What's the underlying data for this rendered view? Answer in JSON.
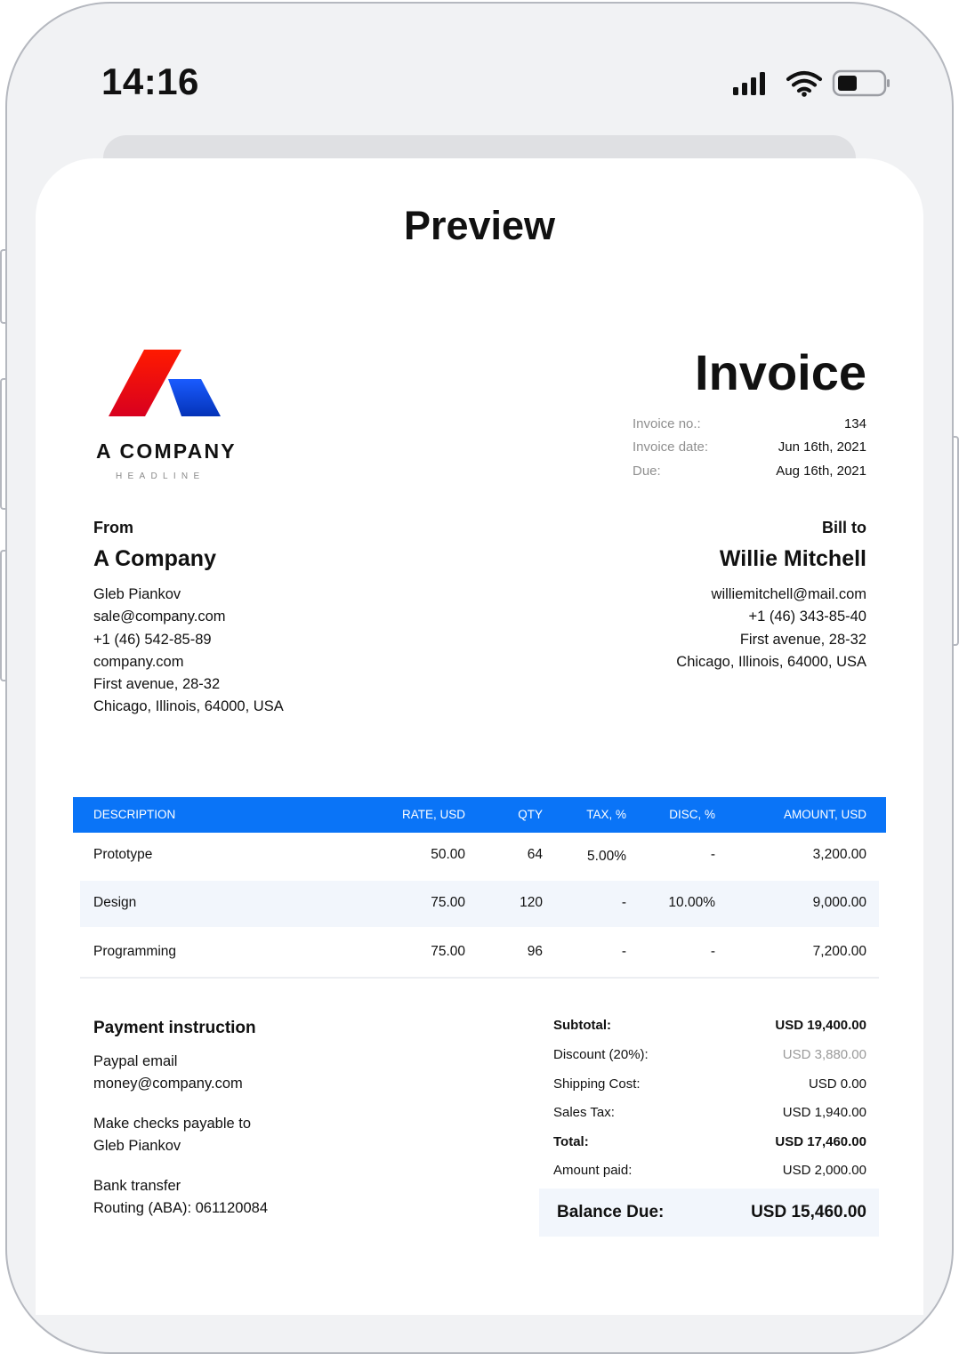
{
  "status_bar": {
    "time": "14:16",
    "icons": [
      "signal-icon",
      "wifi-icon",
      "battery-icon"
    ]
  },
  "sheet": {
    "title": "Preview"
  },
  "company": {
    "name": "A COMPANY",
    "headline": "HEADLINE",
    "logo_colors": [
      "#ff0000",
      "#0047e0"
    ]
  },
  "invoice": {
    "title": "Invoice",
    "meta": [
      {
        "label": "Invoice no.:",
        "value": "134"
      },
      {
        "label": "Invoice date:",
        "value": "Jun 16th, 2021"
      },
      {
        "label": "Due:",
        "value": "Aug 16th, 2021"
      }
    ]
  },
  "from": {
    "heading": "From",
    "name": "A Company",
    "lines": [
      "Gleb Piankov",
      "sale@company.com",
      "+1 (46) 542-85-89",
      "company.com",
      "First avenue, 28-32",
      "Chicago, Illinois, 64000, USA"
    ]
  },
  "bill_to": {
    "heading": "Bill to",
    "name": "Willie Mitchell",
    "lines": [
      "williemitchell@mail.com",
      "+1 (46) 343-85-40",
      "First avenue, 28-32",
      "Chicago, Illinois, 64000, USA"
    ]
  },
  "table": {
    "header_color": "#0a74f7",
    "columns": [
      "DESCRIPTION",
      "RATE, USD",
      "QTY",
      "TAX, %",
      "DISC, %",
      "AMOUNT, USD"
    ],
    "rows": [
      [
        "Prototype",
        "50.00",
        "64",
        "5.00%",
        "-",
        "3,200.00"
      ],
      [
        "Design",
        "75.00",
        "120",
        "-",
        "10.00%",
        "9,000.00"
      ],
      [
        "Programming",
        "75.00",
        "96",
        "-",
        "-",
        "7,200.00"
      ]
    ]
  },
  "payment": {
    "title": "Payment instruction",
    "groups": [
      [
        "Paypal email",
        "money@company.com"
      ],
      [
        "Make checks payable to",
        "Gleb Piankov"
      ],
      [
        "Bank transfer",
        "Routing (ABA): 061120084"
      ]
    ]
  },
  "totals": {
    "rows": [
      {
        "label": "Subtotal:",
        "value": "USD 19,400.00"
      },
      {
        "label": "Discount (20%):",
        "value": "USD 3,880.00"
      },
      {
        "label": "Shipping Cost:",
        "value": "USD 0.00"
      },
      {
        "label": "Sales Tax:",
        "value": "USD 1,940.00"
      },
      {
        "label": "Total:",
        "value": "USD 17,460.00"
      },
      {
        "label": "Amount paid:",
        "value": "USD 2,000.00"
      }
    ],
    "balance_label": "Balance Due:",
    "balance_value": "USD 15,460.00"
  }
}
